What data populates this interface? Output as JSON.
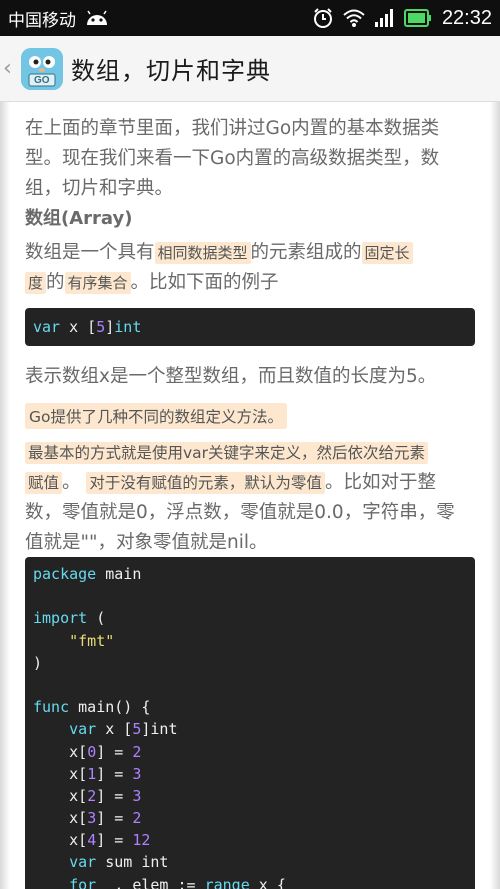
{
  "status": {
    "carrier": "中国移动",
    "time": "22:32"
  },
  "header": {
    "title": "数组，切片和字典",
    "icon_text": "GO"
  },
  "content": {
    "intro_line1": "在上面的章节里面，我们讲过Go内置的基本数据类",
    "intro_line2": "型。现在我们来看一下Go内置的高级数据类型，数",
    "intro_line3": "组，切片和字典。",
    "heading_array": "数组(Array)",
    "desc_a": "数组是一个具有",
    "desc_hl1": "相同数据类型",
    "desc_b": "的元素组成的",
    "desc_hl2a": "固定长",
    "desc_hl2b": "度",
    "desc_c": "的",
    "desc_hl3": "有序集合",
    "desc_d": "。比如下面的例子",
    "code1_var": "var",
    "code1_x": " x [",
    "code1_5": "5",
    "code1_close": "]",
    "code1_int": "int",
    "explain": "表示数组x是一个整型数组，而且数值的长度为5。",
    "note_methods": "Go提供了几种不同的数组定义方法。",
    "basic_a": "最基本的方式就是使用var关键字来定义，然后依次给元素",
    "basic_b": "赋值",
    "basic_c": "。",
    "basic_hl2": "对于没有赋值的元素，默认为零值",
    "basic_d": "。比如对于整",
    "zero_line2": "数，零值就是0，浮点数，零值就是0.0，字符串，零",
    "zero_line3": "值就是\"\"，对象零值就是nil。"
  },
  "code2": {
    "l1": [
      "package",
      " main"
    ],
    "l3": [
      "import",
      " ("
    ],
    "l4": "    \"fmt\"",
    "l5": ")",
    "l7": [
      "func",
      " main() {"
    ],
    "l8": [
      "    ",
      "var",
      " x [",
      "5",
      "]int"
    ],
    "l9": [
      "    x[",
      "0",
      "] = ",
      "2"
    ],
    "l10": [
      "    x[",
      "1",
      "] = ",
      "3"
    ],
    "l11": [
      "    x[",
      "2",
      "] = ",
      "3"
    ],
    "l12": [
      "    x[",
      "3",
      "] = ",
      "2"
    ],
    "l13": [
      "    x[",
      "4",
      "] = ",
      "12"
    ],
    "l14": [
      "    ",
      "var",
      " sum int"
    ],
    "l15": [
      "    ",
      "for",
      " _, elem := ",
      "range",
      " x {"
    ]
  },
  "colors": {
    "highlight": "#fde8cf",
    "code_bg": "#232323",
    "keyword": "#66d9ef",
    "number": "#ae81ff",
    "string": "#e6db74"
  }
}
